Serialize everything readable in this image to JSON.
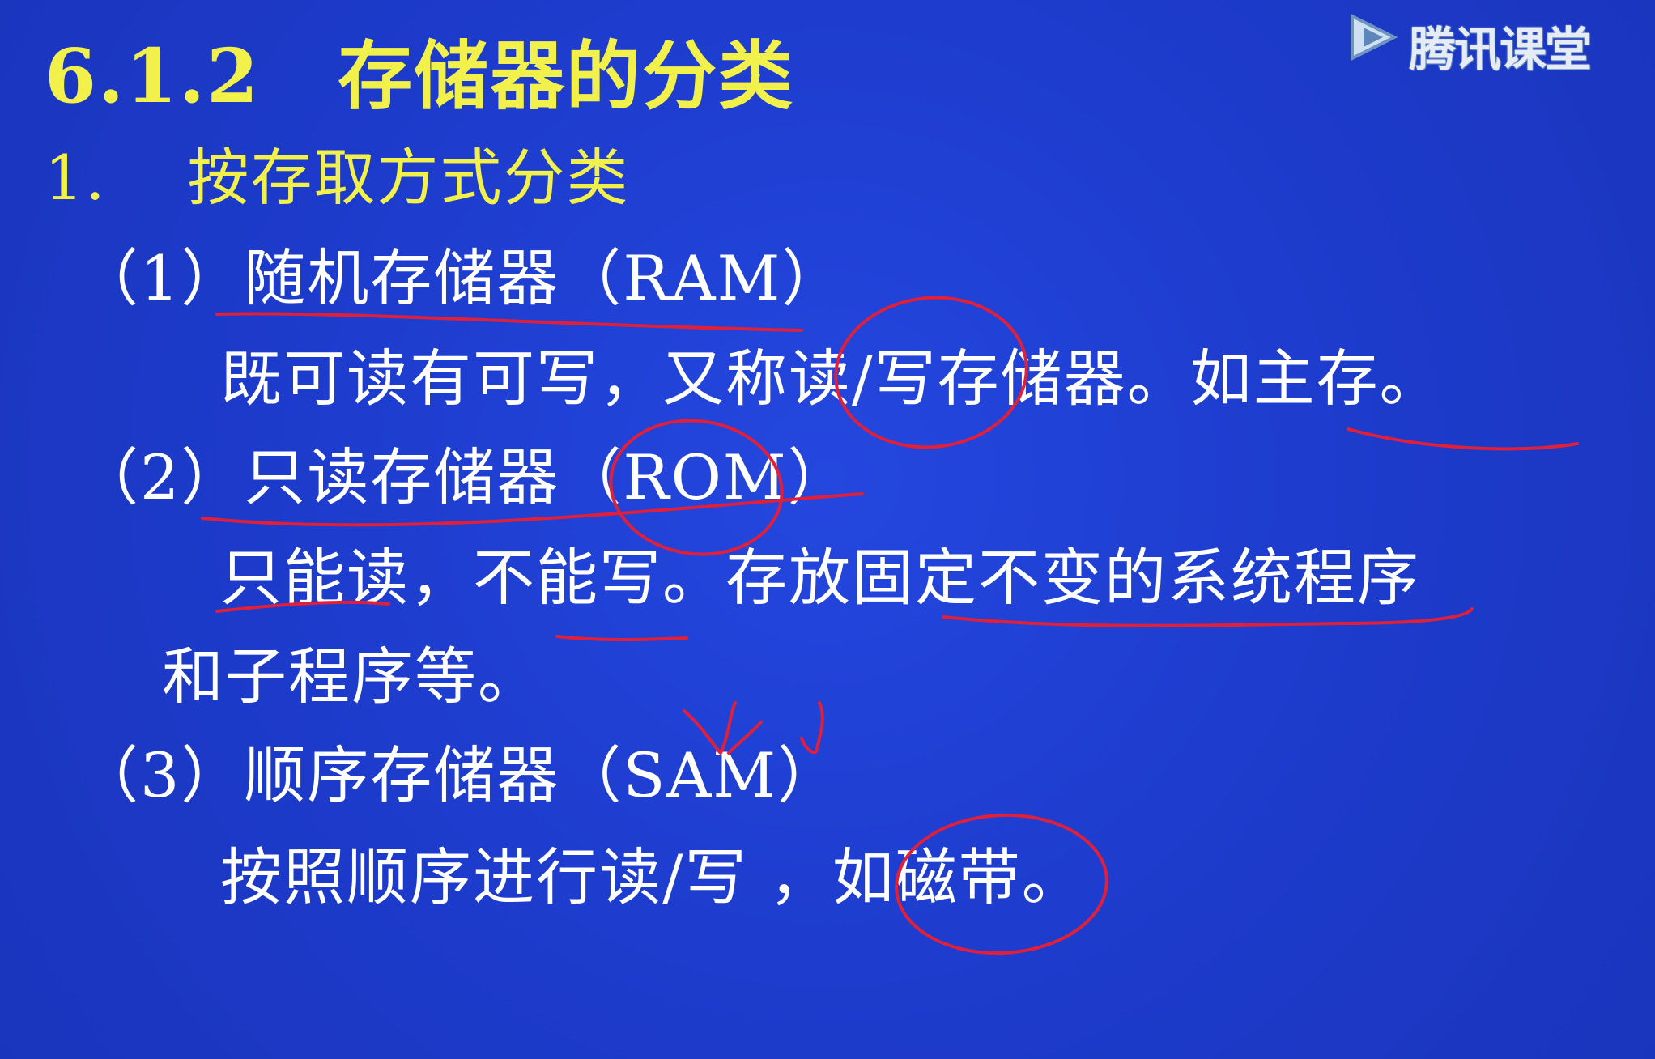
{
  "slide": {
    "background_color": "#1f3fd0",
    "title": {
      "number": "6.1.2",
      "text": "存储器的分类",
      "color": "#f2f04a"
    },
    "subtitle": {
      "number": "1.",
      "text": "按存取方式分类",
      "color": "#f2f04a"
    },
    "items": [
      {
        "label": "（1）随机存储器（RAM）",
        "description": [
          "既可读有可写，又称读/写存储器。如主存。"
        ]
      },
      {
        "label": "（2）只读存储器（ROM）",
        "description": [
          "只能读，不能写。存放固定不变的系统程序",
          "和子程序等。"
        ]
      },
      {
        "label": "（3）顺序存储器（SAM）",
        "description": [
          "按照顺序进行读/写 ，如磁带。"
        ]
      }
    ],
    "text_color": "#ffffff",
    "annotation_color": "#e0203a"
  },
  "watermark": {
    "brand_text": "腾讯课堂",
    "icon": "play-logo-icon"
  }
}
